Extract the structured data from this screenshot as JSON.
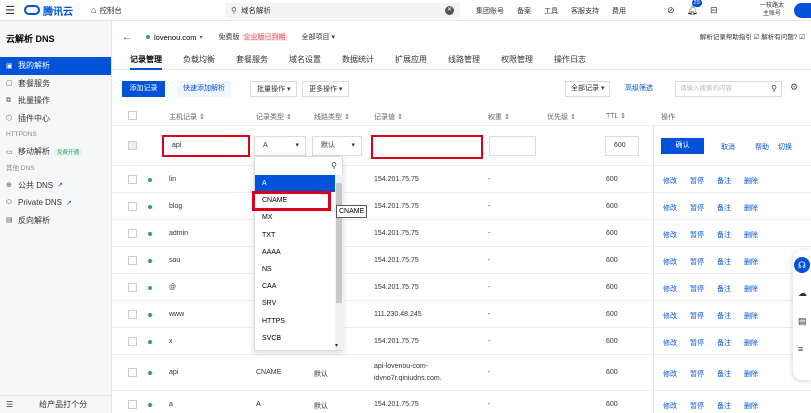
{
  "topbar": {
    "menu_icon": "hamburger-icon",
    "logo": "腾讯云",
    "console": "控制台",
    "search_value": "域名解析",
    "links": [
      "集团账号",
      "备案",
      "工具",
      "客服支持",
      "费用"
    ],
    "notif_count": "29",
    "user_line1": "一枝路太",
    "user_line2": "主账号"
  },
  "sidebar": {
    "title": "云解析 DNS",
    "items": [
      {
        "label": "我的解析",
        "icon": "dns-icon"
      },
      {
        "label": "套餐服务",
        "icon": "package-icon"
      },
      {
        "label": "批量操作",
        "icon": "batch-icon"
      },
      {
        "label": "插件中心",
        "icon": "plugin-icon"
      }
    ],
    "group1": "HTTPDNS",
    "mobile": {
      "label": "移动解析",
      "tag": "免费开通"
    },
    "group2": "其他 DNS",
    "public_dns": "公共 DNS",
    "private_dns": "Private DNS",
    "reverse": "反向解析",
    "feedback": "给产品打个分"
  },
  "header": {
    "domain": "lovenou.com",
    "plan_prefix": "免费版",
    "plan_warn": "企业版已到期",
    "project": "全部项目",
    "right_text": "解析记录帮助指引 ☑  解析有问题? ☑"
  },
  "tabs": [
    "记录管理",
    "负载均衡",
    "套餐服务",
    "域名设置",
    "数据统计",
    "扩展应用",
    "线路管理",
    "权限管理",
    "操作日志"
  ],
  "toolbar": {
    "add": "添加记录",
    "quick": "快速添加解析",
    "batch": "批量操作 ▾",
    "more": "更多操作 ▾",
    "filter": "全部记录 ▾",
    "advanced": "高级筛选",
    "search_placeholder": "请输入搜索的内容"
  },
  "table": {
    "headers": [
      "主机记录 ⇕",
      "记录类型 ⇕",
      "线路类型 ⇕",
      "记录值 ⇕",
      "权重 ⇕",
      "优先级 ⇕",
      "TTL ⇕",
      "操作"
    ],
    "edit_row": {
      "host": "api",
      "type": "A",
      "line": "默认",
      "ttl": "600",
      "confirm": "确认",
      "cancel": "取消",
      "help": "帮助",
      "switch": "切换"
    },
    "rows": [
      {
        "host": "lin",
        "type": "",
        "line": "",
        "value": "154.201.75.75",
        "weight": "-",
        "ttl": "600"
      },
      {
        "host": "blog",
        "type": "",
        "line": "",
        "value": "154.201.75.75",
        "weight": "-",
        "ttl": "600"
      },
      {
        "host": "admin",
        "type": "",
        "line": "",
        "value": "154.201.75.75",
        "weight": "-",
        "ttl": "600"
      },
      {
        "host": "sou",
        "type": "",
        "line": "",
        "value": "154.201.75.75",
        "weight": "-",
        "ttl": "600"
      },
      {
        "host": "@",
        "type": "",
        "line": "",
        "value": "154.201.75.75",
        "weight": "-",
        "ttl": "600"
      },
      {
        "host": "www",
        "type": "",
        "line": "",
        "value": "111.230.48.245",
        "weight": "-",
        "ttl": "600"
      },
      {
        "host": "x",
        "type": "",
        "line": "",
        "value": "154.201.75.75",
        "weight": "-",
        "ttl": "600"
      },
      {
        "host": "api",
        "type": "CNAME",
        "line": "默认",
        "value": "api-lovenou-com-",
        "value2": "idvno7r.qiniudns.com.",
        "weight": "-",
        "ttl": "600"
      },
      {
        "host": "a",
        "type": "A",
        "line": "默认",
        "value": "154.201.75.75",
        "weight": "-",
        "ttl": "600"
      }
    ],
    "ops": [
      "修改",
      "暂停",
      "备注",
      "删除"
    ]
  },
  "dropdown": {
    "options": [
      "A",
      "CNAME",
      "MX",
      "TXT",
      "AAAA",
      "NS",
      "CAA",
      "SRV",
      "HTTPS",
      "SVCB"
    ],
    "tooltip": "CNAME"
  }
}
